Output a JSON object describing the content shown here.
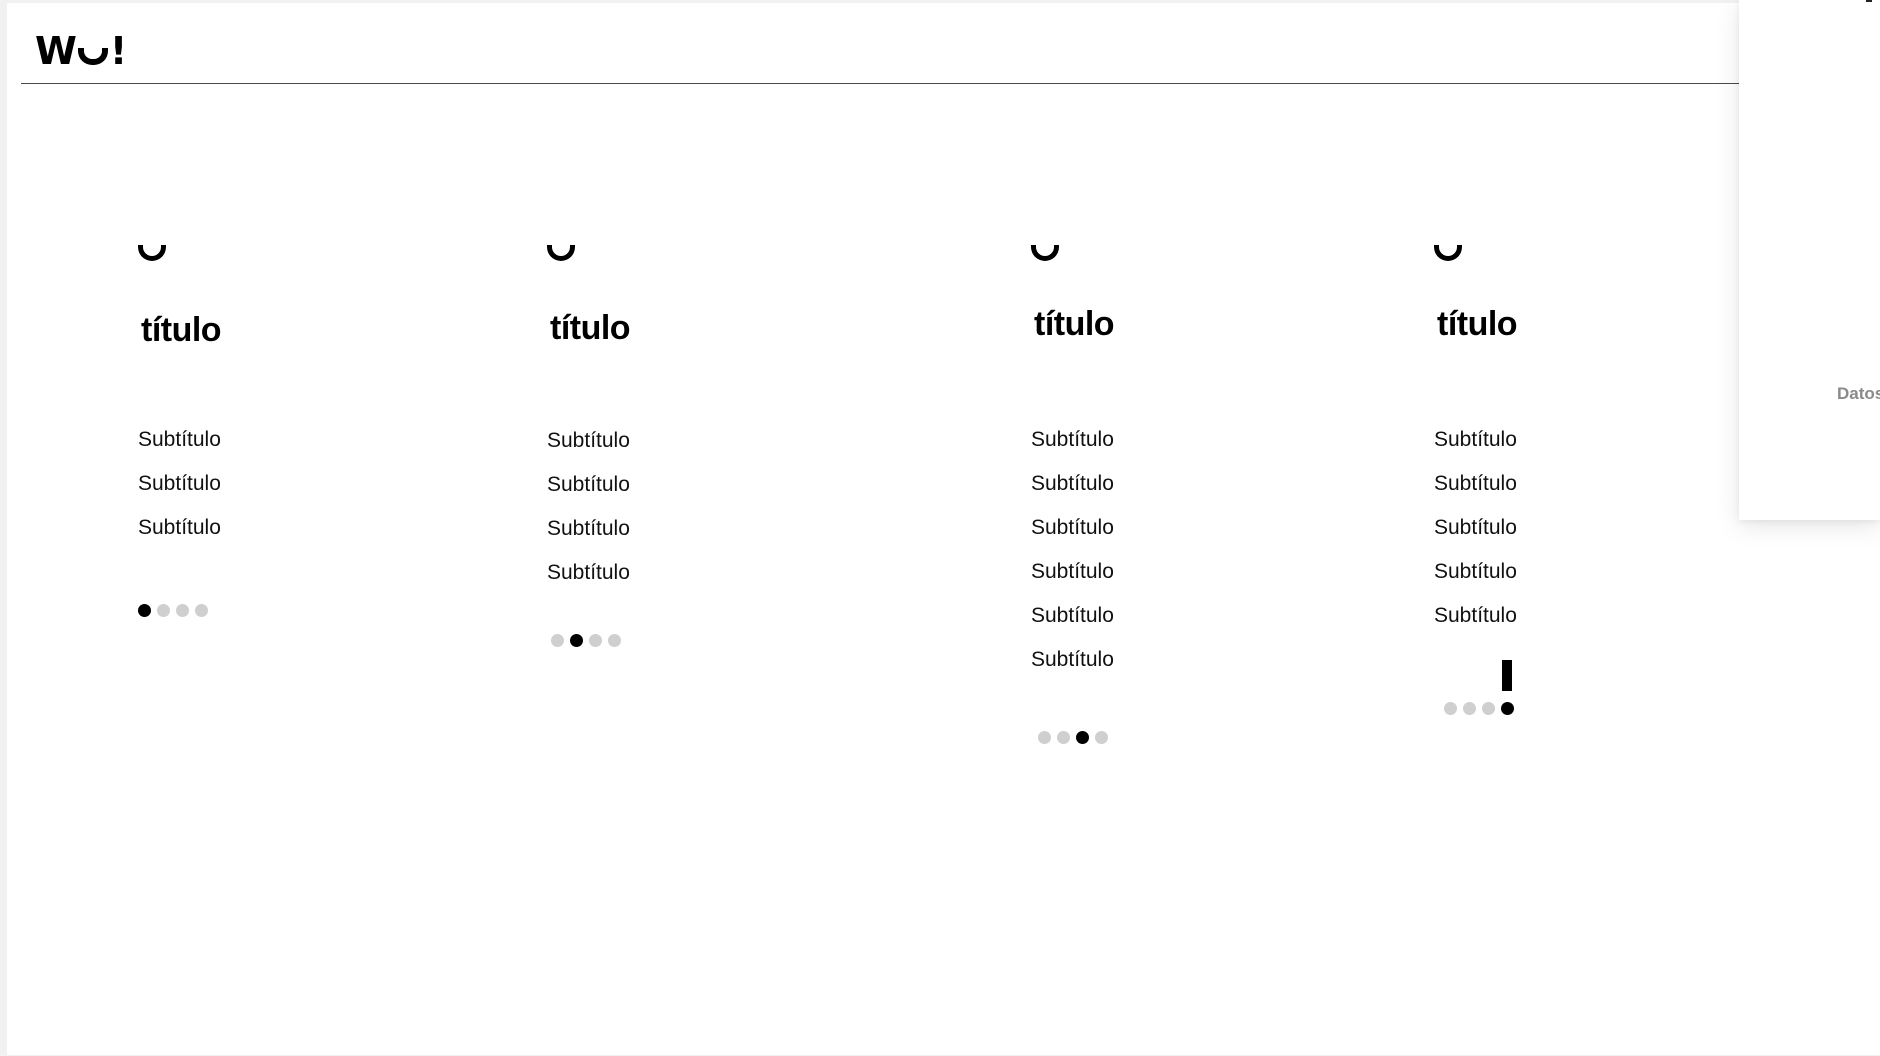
{
  "header": {
    "logo_text": "Wu!"
  },
  "columns": [
    {
      "title": "título",
      "subtitles": [
        "Subtítulo",
        "Subtítulo",
        "Subtítulo"
      ],
      "active_dot": 1
    },
    {
      "title": "título",
      "subtitles": [
        "Subtítulo",
        "Subtítulo",
        "Subtítulo",
        "Subtítulo"
      ],
      "active_dot": 2
    },
    {
      "title": "título",
      "subtitles": [
        "Subtítulo",
        "Subtítulo",
        "Subtítulo",
        "Subtítulo",
        "Subtítulo",
        "Subtítulo"
      ],
      "active_dot": 3
    },
    {
      "title": "título",
      "subtitles": [
        "Subtítulo",
        "Subtítulo",
        "Subtítulo",
        "Subtítulo",
        "Subtítulo"
      ],
      "active_dot": 4
    }
  ],
  "dot_count": 4,
  "side_panel": {
    "label": "Datos"
  },
  "colors": {
    "active_dot": "#000000",
    "inactive_dot": "#cfcfcf",
    "text": "#111111"
  }
}
